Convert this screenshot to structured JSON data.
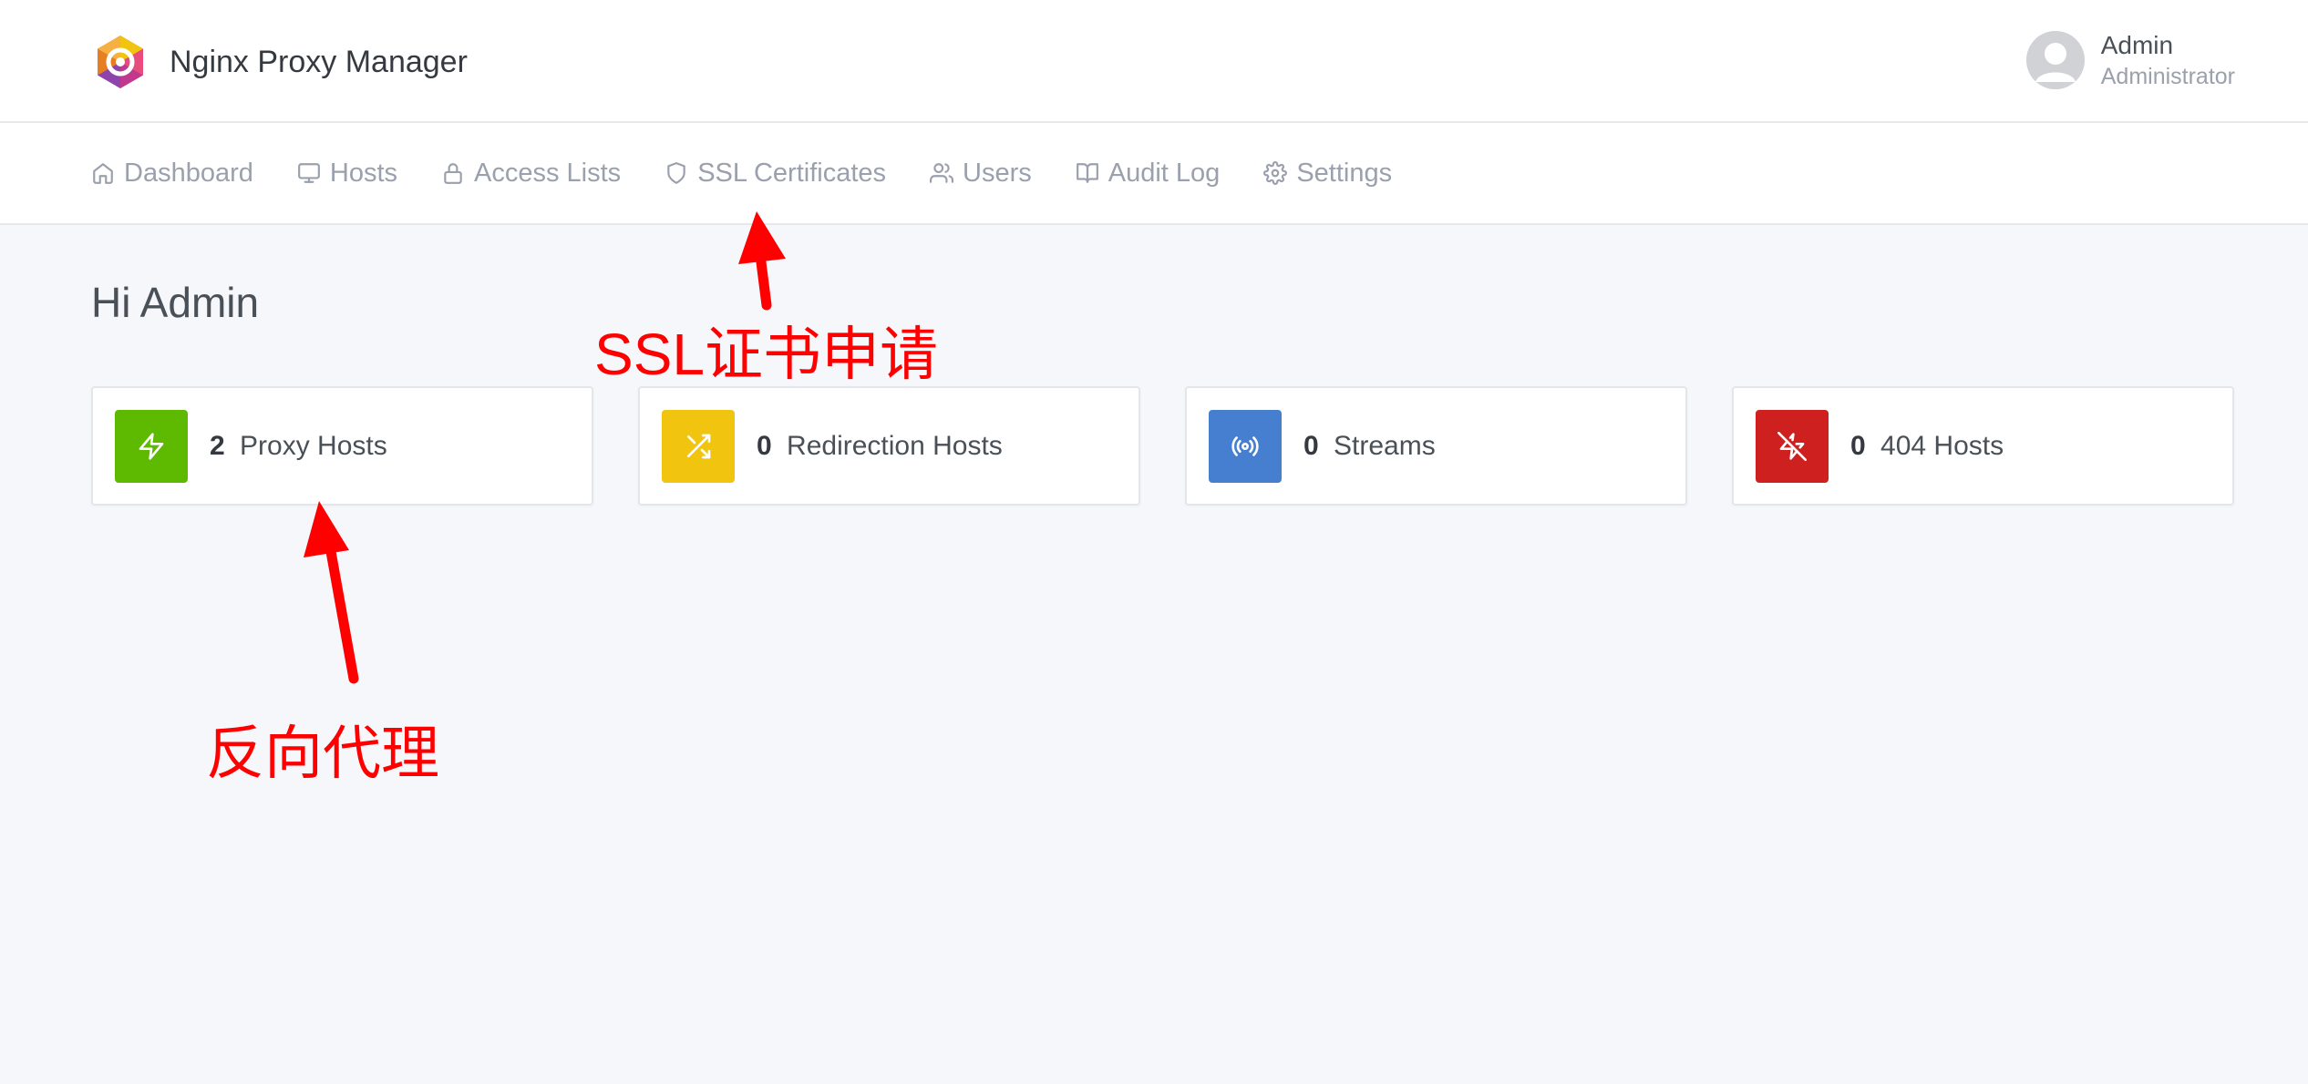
{
  "header": {
    "app_name": "Nginx Proxy Manager",
    "user": {
      "name": "Admin",
      "role": "Administrator"
    }
  },
  "nav": {
    "items": [
      {
        "label": "Dashboard",
        "icon": "home-icon"
      },
      {
        "label": "Hosts",
        "icon": "monitor-icon"
      },
      {
        "label": "Access Lists",
        "icon": "lock-icon"
      },
      {
        "label": "SSL Certificates",
        "icon": "shield-icon"
      },
      {
        "label": "Users",
        "icon": "users-icon"
      },
      {
        "label": "Audit Log",
        "icon": "book-icon"
      },
      {
        "label": "Settings",
        "icon": "gear-icon"
      }
    ]
  },
  "main": {
    "greeting": "Hi Admin",
    "cards": [
      {
        "count": "2",
        "label": "Proxy Hosts",
        "icon": "lightning-icon",
        "color": "#5eba00"
      },
      {
        "count": "0",
        "label": "Redirection Hosts",
        "icon": "shuffle-icon",
        "color": "#f1c40f"
      },
      {
        "count": "0",
        "label": "Streams",
        "icon": "radio-icon",
        "color": "#467fcf"
      },
      {
        "count": "0",
        "label": "404 Hosts",
        "icon": "zap-off-icon",
        "color": "#cd201f"
      }
    ]
  },
  "annotations": {
    "ssl": "SSL证书申请",
    "proxy": "反向代理",
    "color": "#ff0000"
  }
}
